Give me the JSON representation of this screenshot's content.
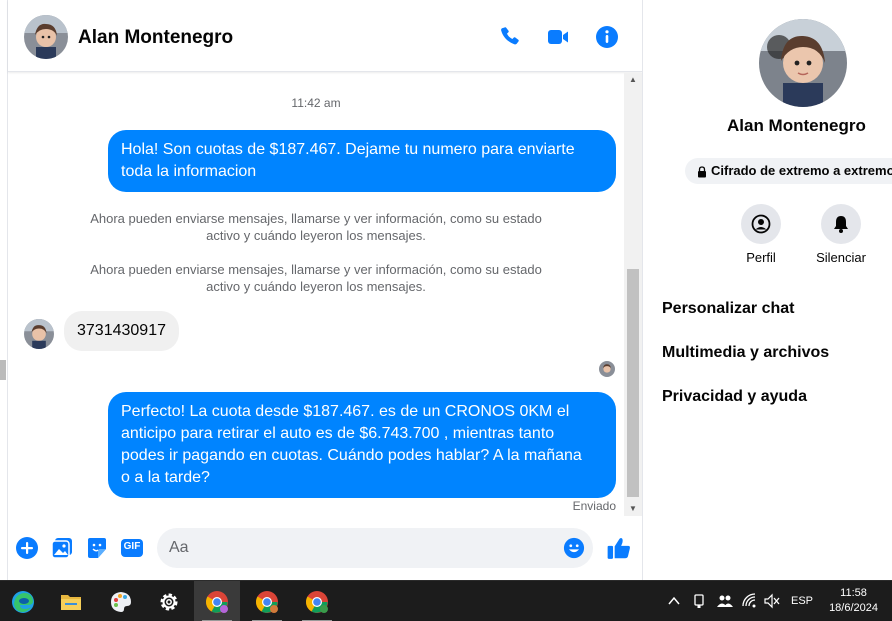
{
  "chat": {
    "contact_name": "Alan Montenegro",
    "header_icons": [
      "phone-icon",
      "video-camera-icon",
      "info-icon"
    ],
    "accent_color": "#0084ff",
    "messages": {
      "timestamp": "11:42 am",
      "outgoing_1": [
        "Hola! Son cuotas de $187.467. Dejame tu numero para enviarte",
        "toda la informacion"
      ],
      "system_1": [
        "Ahora pueden enviarse mensajes, llamarse y ver información, como su estado",
        "activo y cuándo leyeron los mensajes."
      ],
      "system_2": [
        "Ahora pueden enviarse mensajes, llamarse y ver información, como su estado",
        "activo y cuándo leyeron los mensajes."
      ],
      "incoming_1": "3731430917",
      "outgoing_2": [
        "Perfecto! La cuota desde $187.467. es de un CRONOS 0KM el",
        "anticipo para retirar el auto es de $6.743.700 , mientras tanto",
        "podes ir pagando en cuotas. Cuándo podes hablar? A la mañana",
        "o a la tarde?"
      ],
      "status": "Enviado"
    },
    "composer": {
      "placeholder": "Aa",
      "icons": [
        "add-icon",
        "image-icon",
        "sticker-icon",
        "gif-icon",
        "emoji-icon",
        "like-icon"
      ],
      "gif_label": "GIF"
    }
  },
  "panel": {
    "name": "Alan Montenegro",
    "encryption": "Cifrado de extremo a extremo",
    "actions": [
      {
        "label": "Perfil",
        "icon": "profile-icon"
      },
      {
        "label": "Silenciar",
        "icon": "bell-icon"
      }
    ],
    "menu": [
      "Personalizar chat",
      "Multimedia y archivos",
      "Privacidad y ayuda"
    ]
  },
  "taskbar": {
    "apps": [
      "edge-icon",
      "file-explorer-icon",
      "paint-icon",
      "settings-icon",
      "chrome-icon",
      "chrome-icon",
      "chrome-icon"
    ],
    "language": "ESP",
    "time": "11:58",
    "date": "18/6/2024"
  }
}
